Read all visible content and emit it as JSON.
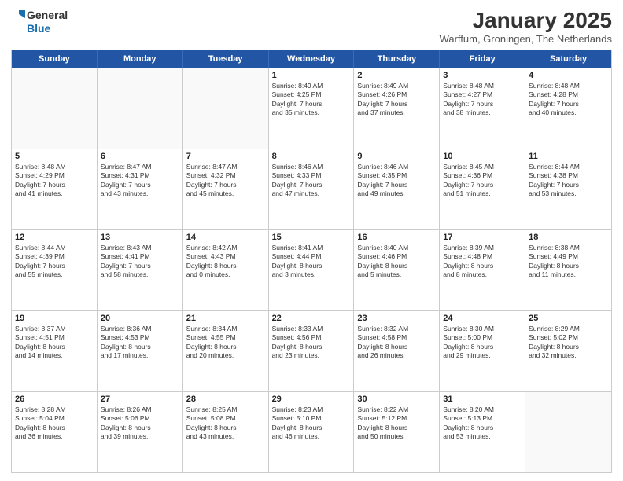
{
  "header": {
    "logo_line1": "General",
    "logo_line2": "Blue",
    "month": "January 2025",
    "location": "Warffum, Groningen, The Netherlands"
  },
  "days_of_week": [
    "Sunday",
    "Monday",
    "Tuesday",
    "Wednesday",
    "Thursday",
    "Friday",
    "Saturday"
  ],
  "weeks": [
    [
      {
        "day": "",
        "text": ""
      },
      {
        "day": "",
        "text": ""
      },
      {
        "day": "",
        "text": ""
      },
      {
        "day": "1",
        "text": "Sunrise: 8:49 AM\nSunset: 4:25 PM\nDaylight: 7 hours\nand 35 minutes."
      },
      {
        "day": "2",
        "text": "Sunrise: 8:49 AM\nSunset: 4:26 PM\nDaylight: 7 hours\nand 37 minutes."
      },
      {
        "day": "3",
        "text": "Sunrise: 8:48 AM\nSunset: 4:27 PM\nDaylight: 7 hours\nand 38 minutes."
      },
      {
        "day": "4",
        "text": "Sunrise: 8:48 AM\nSunset: 4:28 PM\nDaylight: 7 hours\nand 40 minutes."
      }
    ],
    [
      {
        "day": "5",
        "text": "Sunrise: 8:48 AM\nSunset: 4:29 PM\nDaylight: 7 hours\nand 41 minutes."
      },
      {
        "day": "6",
        "text": "Sunrise: 8:47 AM\nSunset: 4:31 PM\nDaylight: 7 hours\nand 43 minutes."
      },
      {
        "day": "7",
        "text": "Sunrise: 8:47 AM\nSunset: 4:32 PM\nDaylight: 7 hours\nand 45 minutes."
      },
      {
        "day": "8",
        "text": "Sunrise: 8:46 AM\nSunset: 4:33 PM\nDaylight: 7 hours\nand 47 minutes."
      },
      {
        "day": "9",
        "text": "Sunrise: 8:46 AM\nSunset: 4:35 PM\nDaylight: 7 hours\nand 49 minutes."
      },
      {
        "day": "10",
        "text": "Sunrise: 8:45 AM\nSunset: 4:36 PM\nDaylight: 7 hours\nand 51 minutes."
      },
      {
        "day": "11",
        "text": "Sunrise: 8:44 AM\nSunset: 4:38 PM\nDaylight: 7 hours\nand 53 minutes."
      }
    ],
    [
      {
        "day": "12",
        "text": "Sunrise: 8:44 AM\nSunset: 4:39 PM\nDaylight: 7 hours\nand 55 minutes."
      },
      {
        "day": "13",
        "text": "Sunrise: 8:43 AM\nSunset: 4:41 PM\nDaylight: 7 hours\nand 58 minutes."
      },
      {
        "day": "14",
        "text": "Sunrise: 8:42 AM\nSunset: 4:43 PM\nDaylight: 8 hours\nand 0 minutes."
      },
      {
        "day": "15",
        "text": "Sunrise: 8:41 AM\nSunset: 4:44 PM\nDaylight: 8 hours\nand 3 minutes."
      },
      {
        "day": "16",
        "text": "Sunrise: 8:40 AM\nSunset: 4:46 PM\nDaylight: 8 hours\nand 5 minutes."
      },
      {
        "day": "17",
        "text": "Sunrise: 8:39 AM\nSunset: 4:48 PM\nDaylight: 8 hours\nand 8 minutes."
      },
      {
        "day": "18",
        "text": "Sunrise: 8:38 AM\nSunset: 4:49 PM\nDaylight: 8 hours\nand 11 minutes."
      }
    ],
    [
      {
        "day": "19",
        "text": "Sunrise: 8:37 AM\nSunset: 4:51 PM\nDaylight: 8 hours\nand 14 minutes."
      },
      {
        "day": "20",
        "text": "Sunrise: 8:36 AM\nSunset: 4:53 PM\nDaylight: 8 hours\nand 17 minutes."
      },
      {
        "day": "21",
        "text": "Sunrise: 8:34 AM\nSunset: 4:55 PM\nDaylight: 8 hours\nand 20 minutes."
      },
      {
        "day": "22",
        "text": "Sunrise: 8:33 AM\nSunset: 4:56 PM\nDaylight: 8 hours\nand 23 minutes."
      },
      {
        "day": "23",
        "text": "Sunrise: 8:32 AM\nSunset: 4:58 PM\nDaylight: 8 hours\nand 26 minutes."
      },
      {
        "day": "24",
        "text": "Sunrise: 8:30 AM\nSunset: 5:00 PM\nDaylight: 8 hours\nand 29 minutes."
      },
      {
        "day": "25",
        "text": "Sunrise: 8:29 AM\nSunset: 5:02 PM\nDaylight: 8 hours\nand 32 minutes."
      }
    ],
    [
      {
        "day": "26",
        "text": "Sunrise: 8:28 AM\nSunset: 5:04 PM\nDaylight: 8 hours\nand 36 minutes."
      },
      {
        "day": "27",
        "text": "Sunrise: 8:26 AM\nSunset: 5:06 PM\nDaylight: 8 hours\nand 39 minutes."
      },
      {
        "day": "28",
        "text": "Sunrise: 8:25 AM\nSunset: 5:08 PM\nDaylight: 8 hours\nand 43 minutes."
      },
      {
        "day": "29",
        "text": "Sunrise: 8:23 AM\nSunset: 5:10 PM\nDaylight: 8 hours\nand 46 minutes."
      },
      {
        "day": "30",
        "text": "Sunrise: 8:22 AM\nSunset: 5:12 PM\nDaylight: 8 hours\nand 50 minutes."
      },
      {
        "day": "31",
        "text": "Sunrise: 8:20 AM\nSunset: 5:13 PM\nDaylight: 8 hours\nand 53 minutes."
      },
      {
        "day": "",
        "text": ""
      }
    ]
  ]
}
